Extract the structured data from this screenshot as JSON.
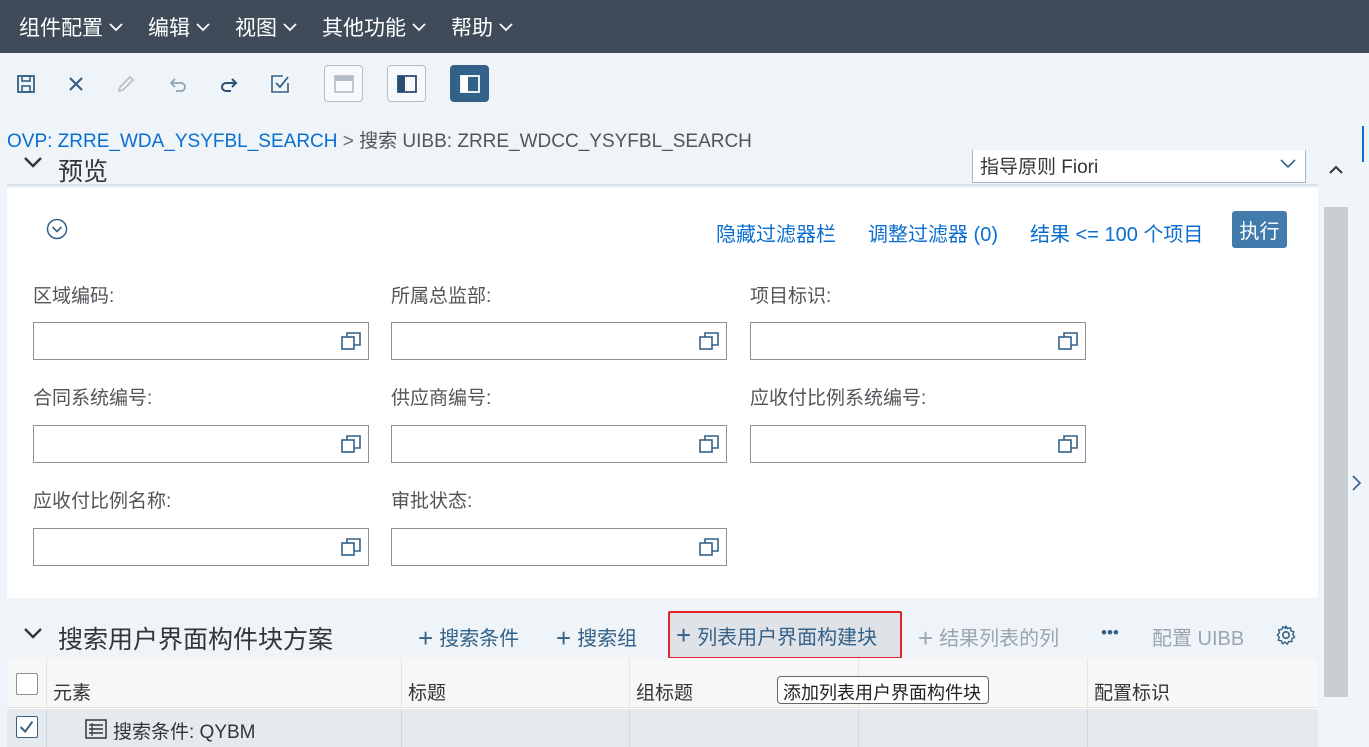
{
  "menu": {
    "items": [
      {
        "label": "组件配置"
      },
      {
        "label": "编辑"
      },
      {
        "label": "视图"
      },
      {
        "label": "其他功能"
      },
      {
        "label": "帮助"
      }
    ]
  },
  "toolbar": {
    "icons": [
      "save-icon",
      "close-icon",
      "edit-icon",
      "undo-icon",
      "redo-icon",
      "check-icon",
      "layout-top-icon",
      "layout-left-panel-icon",
      "layout-left-panel-active-icon"
    ]
  },
  "breadcrumb": {
    "link": "OVP: ZRRE_WDA_YSYFBL_SEARCH",
    "separator": ">",
    "current": "搜索 UIBB: ZRRE_WDCC_YSYFBL_SEARCH"
  },
  "preview": {
    "title": "预览",
    "guideline_value": "指导原则 Fiori"
  },
  "filter": {
    "hide_filter_bar": "隐藏过滤器栏",
    "adapt_filters": "调整过滤器 (0)",
    "result_limit": "结果 <= 100 个项目",
    "execute": "执行",
    "fields": [
      {
        "label": "区域编码:",
        "value": ""
      },
      {
        "label": "所属总监部:",
        "value": ""
      },
      {
        "label": "项目标识:",
        "value": ""
      },
      {
        "label": "合同系统编号:",
        "value": ""
      },
      {
        "label": "供应商编号:",
        "value": ""
      },
      {
        "label": "应收付比例系统编号:",
        "value": ""
      },
      {
        "label": "应收付比例名称:",
        "value": ""
      },
      {
        "label": "审批状态:",
        "value": ""
      }
    ]
  },
  "section": {
    "title": "搜索用户界面构件块方案",
    "add_search_criteria": "搜索条件",
    "add_search_group": "搜索组",
    "add_list_uibb": "列表用户界面构建块",
    "add_result_column": "结果列表的列",
    "more": "•••",
    "configure_uibb": "配置 UIBB"
  },
  "tooltip": "添加列表用户界面构件块",
  "table": {
    "headers": [
      "元素",
      "标题",
      "组标题",
      "",
      "配置标识"
    ],
    "rows": [
      {
        "element": "搜索条件: QYBM",
        "title": "",
        "group_title": "",
        "col4": "",
        "config_id": "",
        "checked": true
      }
    ]
  },
  "colors": {
    "menubar_bg": "#3f4b59",
    "link": "#0a6ed1",
    "button_primary": "#427cac",
    "highlight_border": "#e0252b"
  }
}
